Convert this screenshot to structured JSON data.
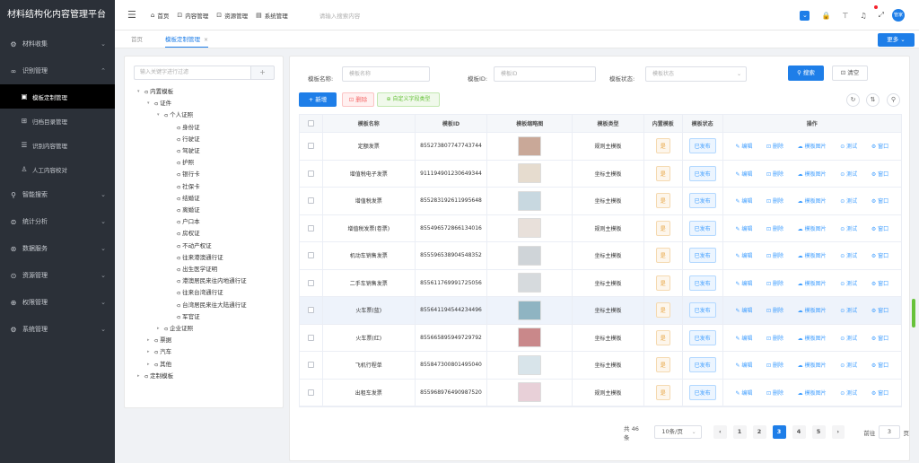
{
  "app": {
    "title": "材料结构化内容管理平台"
  },
  "sidebar": {
    "items": [
      {
        "icon": "gear-icon",
        "glyph": "⚙",
        "label": "材料收集",
        "chev": "⌄"
      },
      {
        "icon": "glasses-icon",
        "glyph": "∞",
        "label": "识别管理",
        "chev": "⌃"
      },
      {
        "icon": "search-icon",
        "glyph": "⚲",
        "label": "智能搜索",
        "chev": "⌄"
      },
      {
        "icon": "chart-icon",
        "glyph": "⊜",
        "label": "统计分析",
        "chev": "⌄"
      },
      {
        "icon": "data-icon",
        "glyph": "⊛",
        "label": "数据服务",
        "chev": "⌄"
      },
      {
        "icon": "resource-icon",
        "glyph": "⊙",
        "label": "资源管理",
        "chev": "⌄"
      },
      {
        "icon": "permission-icon",
        "glyph": "⊕",
        "label": "权限管理",
        "chev": "⌄"
      },
      {
        "icon": "settings-icon",
        "glyph": "⚙",
        "label": "系统管理",
        "chev": "⌄"
      }
    ],
    "sub_items": [
      {
        "icon": "image-icon",
        "glyph": "▣",
        "label": "模板定制管理"
      },
      {
        "icon": "grid-icon",
        "glyph": "⊞",
        "label": "归档目录管理"
      },
      {
        "icon": "list-icon",
        "glyph": "☰",
        "label": "识别内容管理"
      },
      {
        "icon": "user-icon",
        "glyph": "♙",
        "label": "人工内容校对"
      }
    ]
  },
  "topbar": {
    "nav": [
      {
        "icon": "home-icon",
        "glyph": "⌂",
        "label": "首页"
      },
      {
        "icon": "content-icon",
        "glyph": "⊡",
        "label": "内容管理"
      },
      {
        "icon": "resource-icon",
        "glyph": "⊡",
        "label": "资源管理"
      },
      {
        "icon": "system-icon",
        "glyph": "▤",
        "label": "系统管理"
      }
    ],
    "search_placeholder": "请输入搜索内容",
    "avatar_text": "管家"
  },
  "tabs": {
    "home": "首页",
    "current": "模板定制管理",
    "more": "更多 ⌄"
  },
  "tree": {
    "search_placeholder": "输入关键字进行过滤",
    "add": "+",
    "nodes": [
      {
        "label": "内置模板",
        "caret": "▾",
        "indent": 14
      },
      {
        "label": "证件",
        "caret": "▾",
        "indent": 25
      },
      {
        "label": "个人证照",
        "caret": "▾",
        "indent": 36
      },
      {
        "label": "身份证",
        "caret": "",
        "indent": 50
      },
      {
        "label": "行驶证",
        "caret": "",
        "indent": 50
      },
      {
        "label": "驾驶证",
        "caret": "",
        "indent": 50
      },
      {
        "label": "护照",
        "caret": "",
        "indent": 50
      },
      {
        "label": "银行卡",
        "caret": "",
        "indent": 50
      },
      {
        "label": "社保卡",
        "caret": "",
        "indent": 50
      },
      {
        "label": "结婚证",
        "caret": "",
        "indent": 50
      },
      {
        "label": "离婚证",
        "caret": "",
        "indent": 50
      },
      {
        "label": "户口本",
        "caret": "",
        "indent": 50
      },
      {
        "label": "房权证",
        "caret": "",
        "indent": 50
      },
      {
        "label": "不动产权证",
        "caret": "",
        "indent": 50
      },
      {
        "label": "往来港澳通行证",
        "caret": "",
        "indent": 50
      },
      {
        "label": "出生医学证明",
        "caret": "",
        "indent": 50
      },
      {
        "label": "港澳居民来往内地通行证",
        "caret": "",
        "indent": 50
      },
      {
        "label": "往来台湾通行证",
        "caret": "",
        "indent": 50
      },
      {
        "label": "台湾居民来往大陆通行证",
        "caret": "",
        "indent": 50
      },
      {
        "label": "军官证",
        "caret": "",
        "indent": 50
      },
      {
        "label": "企业证照",
        "caret": "▸",
        "indent": 36
      },
      {
        "label": "票据",
        "caret": "▸",
        "indent": 25
      },
      {
        "label": "汽车",
        "caret": "▸",
        "indent": 25
      },
      {
        "label": "其他",
        "caret": "▸",
        "indent": 25
      },
      {
        "label": "定制模板",
        "caret": "▸",
        "indent": 14
      }
    ]
  },
  "filters": {
    "name_label": "模板名称:",
    "name_placeholder": "模板名称",
    "id_label": "模板ID:",
    "id_placeholder": "模板ID",
    "status_label": "模板状态:",
    "status_placeholder": "模板状态",
    "search": "⚲ 搜索",
    "clear": "⊡ 清空"
  },
  "toolbar": {
    "new": "+ 新增",
    "delete": "⊡ 删除",
    "custom": "⊕ 自定义字段类型"
  },
  "table": {
    "headers": [
      "",
      "模板名称",
      "模板ID",
      "模板缩略图",
      "模板类型",
      "内置模板",
      "模板状态",
      "操作"
    ],
    "ops": [
      "✎ 编辑",
      "⊡ 删除",
      "☁ 模板图片",
      "⊙ 测试",
      "⚙ 窗口"
    ],
    "rows": [
      {
        "name": "定额发票",
        "id": "855273807747743744",
        "type": "规则主模板",
        "builtin": "是",
        "status": "已发布",
        "thumb_color": "#c9a898"
      },
      {
        "name": "增值税电子发票",
        "id": "911194901230649344",
        "type": "坐标主模板",
        "builtin": "是",
        "status": "已发布",
        "thumb_color": "#e6dccf"
      },
      {
        "name": "增值税发票",
        "id": "855283192611995648",
        "type": "坐标主模板",
        "builtin": "是",
        "status": "已发布",
        "thumb_color": "#c8d8e0"
      },
      {
        "name": "增值税发票(卷票)",
        "id": "855496572866134016",
        "type": "规则主模板",
        "builtin": "是",
        "status": "已发布",
        "thumb_color": "#e8e0da"
      },
      {
        "name": "机动车销售发票",
        "id": "855596538904548352",
        "type": "坐标主模板",
        "builtin": "是",
        "status": "已发布",
        "thumb_color": "#cfd4d8"
      },
      {
        "name": "二手车销售发票",
        "id": "855611769991725056",
        "type": "坐标主模板",
        "builtin": "是",
        "status": "已发布",
        "thumb_color": "#d6dadd"
      },
      {
        "name": "火车票(蓝)",
        "id": "855641194544234496",
        "type": "坐标主模板",
        "builtin": "是",
        "status": "已发布",
        "thumb_color": "#8fb4c2"
      },
      {
        "name": "火车票(红)",
        "id": "855665895949729792",
        "type": "坐标主模板",
        "builtin": "是",
        "status": "已发布",
        "thumb_color": "#c9888a"
      },
      {
        "name": "飞机行程单",
        "id": "855847300801495040",
        "type": "坐标主模板",
        "builtin": "是",
        "status": "已发布",
        "thumb_color": "#d8e4ea"
      },
      {
        "name": "出租车发票",
        "id": "855968976490987520",
        "type": "规则主模板",
        "builtin": "是",
        "status": "已发布",
        "thumb_color": "#e8d0d8"
      }
    ]
  },
  "pagination": {
    "total": "共 46 条",
    "page_size": "10条/页",
    "prev": "‹",
    "next": "›",
    "pages": [
      "1",
      "2",
      "3",
      "4",
      "5"
    ],
    "current": "3",
    "goto_label": "前往",
    "goto_value": "3",
    "goto_suffix": "页"
  }
}
